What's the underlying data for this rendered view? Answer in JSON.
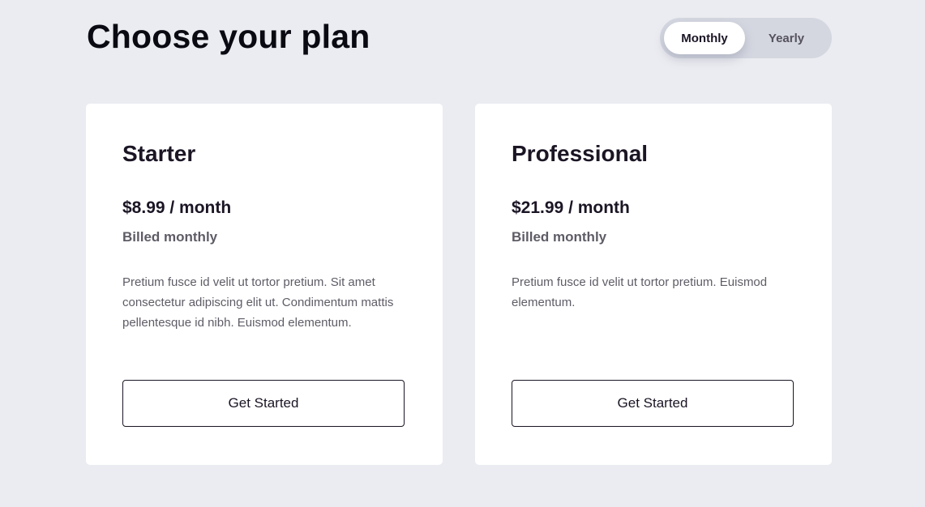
{
  "header": {
    "title": "Choose your plan"
  },
  "billing_toggle": {
    "options": [
      "Monthly",
      "Yearly"
    ],
    "selected": "Monthly"
  },
  "plans": [
    {
      "name": "Starter",
      "price": "$8.99 / month",
      "billing": "Billed monthly",
      "description": "Pretium fusce id velit ut tortor pretium. Sit amet consectetur adipiscing elit ut. Condimentum mattis pellentesque id nibh. Euismod elementum.",
      "cta": "Get Started"
    },
    {
      "name": "Professional",
      "price": "$21.99 / month",
      "billing": "Billed monthly",
      "description": "Pretium fusce id velit ut tortor pretium. Euismod elementum.",
      "cta": "Get Started"
    }
  ]
}
